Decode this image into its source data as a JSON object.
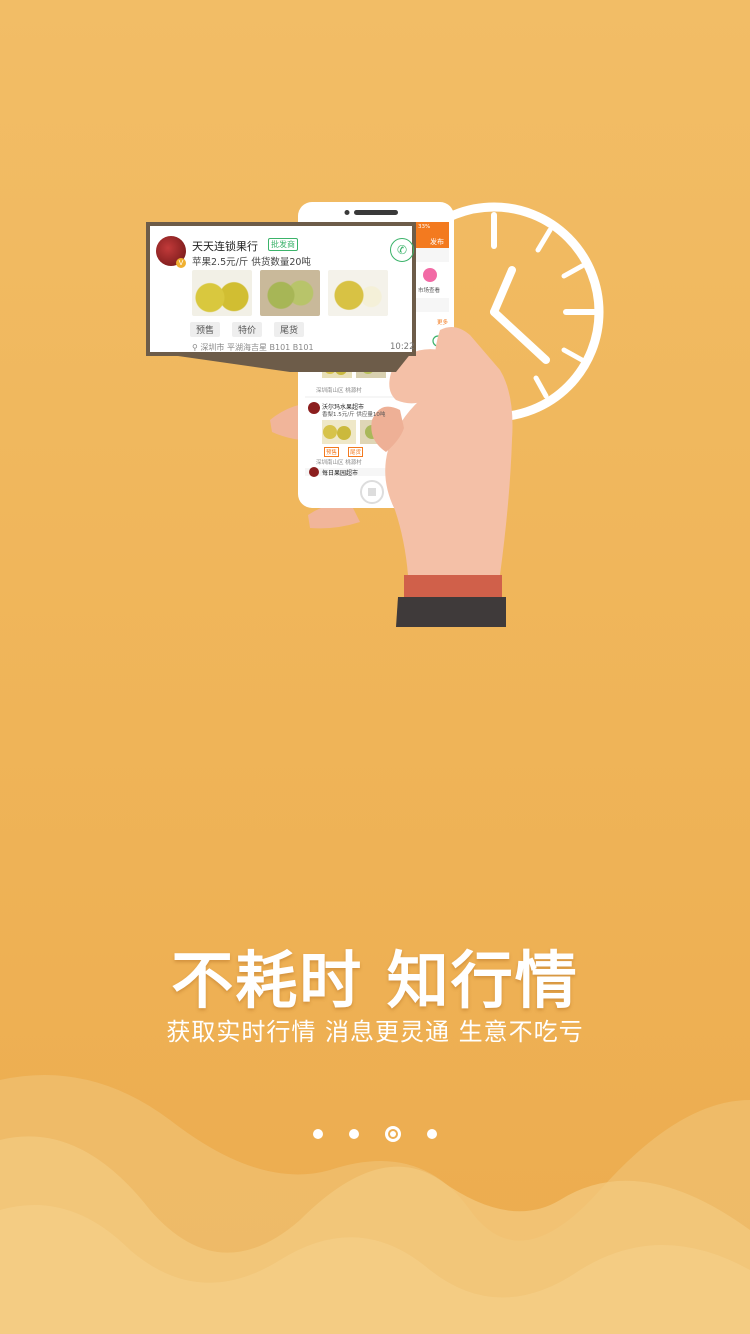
{
  "headline": "不耗时  知行情",
  "subline": "获取实时行情  消息更灵通   生意不吃亏",
  "pager": {
    "count": 4,
    "active_index": 2
  },
  "colors": {
    "background": "#efb458",
    "text": "#ffffff",
    "accent_orange": "#f37a1f",
    "badge_green": "#3bb36a"
  },
  "phone": {
    "battery": "33%",
    "publish_label": "发布",
    "market_label": "市场查看",
    "more_label": "更多",
    "listings": [
      {
        "name": "沃尔玛水果超市",
        "info": "香梨1.5元/斤   供应量10吨",
        "location": "深圳南山区 桃源村",
        "chips": [
          "预售",
          "尾货"
        ]
      },
      {
        "name": "每日果园超市"
      }
    ],
    "top_location": "深圳南山区 桃源村"
  },
  "popup": {
    "seller_name": "天天连锁果行",
    "seller_tag": "批发商",
    "product_info": "苹果2.5元/斤   供货数量20吨",
    "chips": [
      "预售",
      "特价",
      "尾货"
    ],
    "location": "深圳市 平湖海吉星  B101  B101",
    "time": "10:22"
  },
  "icons": [
    "clock-icon",
    "phone-call-icon",
    "location-pin-icon",
    "home-button-icon"
  ]
}
